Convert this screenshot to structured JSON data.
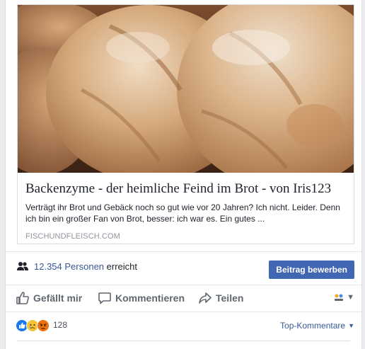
{
  "link_preview": {
    "title": "Backenzyme - der heimliche Feind im Brot - von Iris123",
    "description": "Verträgt ihr Brot und Gebäck noch so gut wie vor 20 Jahren? Ich nicht. Leider. Denn ich bin ein großer Fan von Brot, besser: ich war es. Ein gutes ...",
    "domain": "FISCHUNDFLEISCH.COM"
  },
  "reach": {
    "count": "12.354",
    "people_label": "Personen",
    "suffix": "erreicht",
    "boost_button": "Beitrag bewerben"
  },
  "actions": {
    "like": "Gefällt mir",
    "comment": "Kommentieren",
    "share": "Teilen"
  },
  "reactions": {
    "count": "128",
    "types": [
      "like-icon",
      "sad-icon",
      "angry-icon"
    ],
    "sort_label": "Top-Kommentare"
  },
  "colors": {
    "link": "#365899",
    "button": "#4267b2",
    "gray_text": "#606770"
  }
}
